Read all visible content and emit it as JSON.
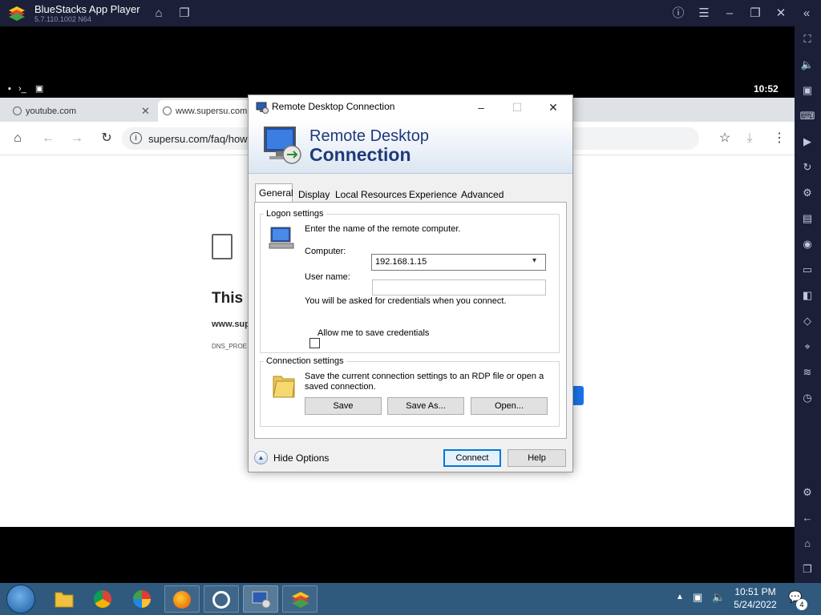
{
  "bluestacks": {
    "title": "BlueStacks App Player",
    "version": "5.7.110.1002 N64",
    "sidebar_icons": [
      "fullscreen-icon",
      "volume-icon",
      "media-icon",
      "keyboard-icon",
      "macro-icon",
      "rotate-icon",
      "controls-icon",
      "apk-icon",
      "screenshot-icon",
      "folder-icon",
      "multi-instance-icon",
      "eco-icon",
      "location-icon",
      "layers-icon",
      "timer-icon",
      "settings-icon",
      "back-icon",
      "home-icon",
      "recents-icon"
    ]
  },
  "android_status": {
    "time": "10:52"
  },
  "browser": {
    "tabs": [
      {
        "label": "youtube.com"
      },
      {
        "label": "www.supersu.com"
      }
    ],
    "url": "supersu.com/faq/how",
    "error": {
      "heading": "This s",
      "site": "www.sup",
      "code": "DNS_PROE"
    }
  },
  "rdp": {
    "window_title": "Remote Desktop Connection",
    "banner_line1": "Remote Desktop",
    "banner_line2": "Connection",
    "tabs": [
      "General",
      "Display",
      "Local Resources",
      "Experience",
      "Advanced"
    ],
    "logon": {
      "group_label": "Logon settings",
      "instruction": "Enter the name of the remote computer.",
      "computer_label": "Computer:",
      "computer_value": "192.168.1.15",
      "username_label": "User name:",
      "username_value": "",
      "credentials_note": "You will be asked for credentials when you connect.",
      "save_credentials_label": "Allow me to save credentials",
      "save_credentials_checked": false
    },
    "connection": {
      "group_label": "Connection settings",
      "description_line1": "Save the current connection settings to an RDP file or open a",
      "description_line2": "saved connection.",
      "save_label": "Save",
      "save_as_label": "Save As...",
      "open_label": "Open..."
    },
    "footer": {
      "hide_options_label": "Hide Options",
      "connect_label": "Connect",
      "help_label": "Help"
    }
  },
  "taskbar": {
    "time": "10:51 PM",
    "date": "5/24/2022",
    "notification_count": "4",
    "items": [
      "explorer",
      "chrome",
      "browser",
      "firefox",
      "app",
      "remote-desktop",
      "bluestacks"
    ]
  },
  "colors": {
    "bluestacks_bar": "#1b1f38",
    "rdp_banner_text": "#1f3a7a",
    "taskbar": "#2f5a7e",
    "accent": "#0078d7"
  }
}
